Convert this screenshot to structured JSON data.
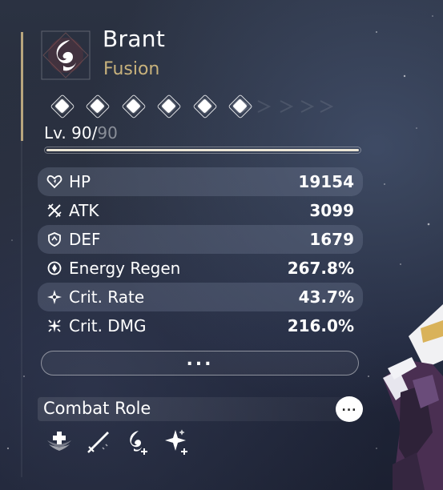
{
  "character": {
    "name": "Brant",
    "element": "Fusion",
    "element_icon": "fusion-swirl-icon",
    "sequence_nodes": 6
  },
  "level": {
    "current": "90",
    "separator": "/",
    "max": "90",
    "prefix": "Lv. ",
    "progress": 1.0
  },
  "stats": [
    {
      "label": "HP",
      "value": "19154",
      "icon": "hp-heart-icon",
      "shaded": true
    },
    {
      "label": "ATK",
      "value": "3099",
      "icon": "atk-swords-icon",
      "shaded": false
    },
    {
      "label": "DEF",
      "value": "1679",
      "icon": "def-shield-icon",
      "shaded": true
    },
    {
      "label": "Energy Regen",
      "value": "267.8%",
      "icon": "energy-regen-icon",
      "shaded": false
    },
    {
      "label": "Crit. Rate",
      "value": "43.7%",
      "icon": "crit-rate-icon",
      "shaded": true
    },
    {
      "label": "Crit. DMG",
      "value": "216.0%",
      "icon": "crit-dmg-icon",
      "shaded": false
    }
  ],
  "more_button": {
    "label": "..."
  },
  "combat_role": {
    "title": "Combat Role",
    "info_label": "...",
    "roles": [
      "healer-role-icon",
      "dps-role-icon",
      "fusion-amplify-role-icon",
      "crit-amplify-role-icon"
    ]
  },
  "colors": {
    "accent_gold": "#c8b27c",
    "row_shade": "#828ca5",
    "background": "#262c3a"
  }
}
